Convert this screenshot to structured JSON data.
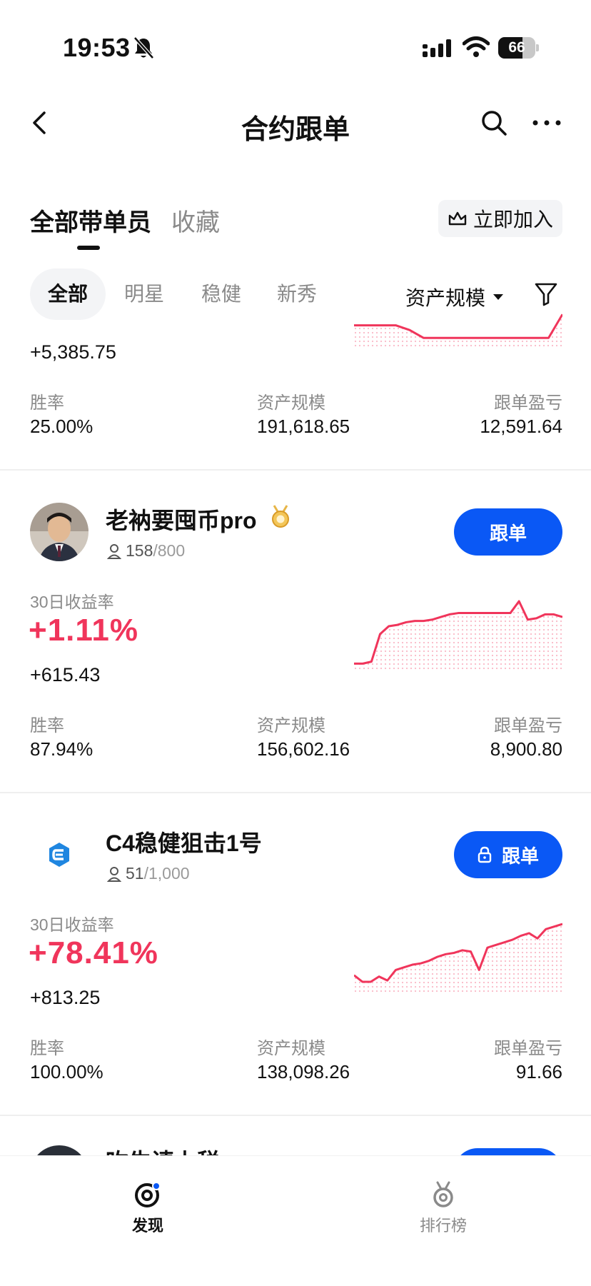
{
  "status_bar": {
    "time": "19:53",
    "battery": "66",
    "battery_level": 0.66
  },
  "header": {
    "title": "合约跟单"
  },
  "tabs": {
    "all": "全部带单员",
    "favorites": "收藏",
    "join": "立即加入"
  },
  "filters": {
    "chips": [
      "全部",
      "明星",
      "稳健",
      "新秀"
    ],
    "sort": "资产规模"
  },
  "stat_labels": {
    "roi": "30日收益率",
    "win_rate": "胜率",
    "aum": "资产规模",
    "copy_pnl": "跟单盈亏"
  },
  "cards": [
    {
      "pnl": "+5,385.75",
      "win_rate": "25.00%",
      "aum": "191,618.65",
      "copy_pnl": "12,591.64",
      "sparkline": [
        0.6,
        0.6,
        0.6,
        0.6,
        0.45,
        0.2,
        0.2,
        0.2,
        0.2,
        0.2,
        0.2,
        0.2,
        0.2,
        0.2,
        0.2,
        0.95
      ]
    },
    {
      "name": "老衲要囤币pro",
      "followers": "158",
      "max_followers": "/800",
      "button": "跟单",
      "locked": false,
      "roi": "+1.11%",
      "pnl": "+615.43",
      "win_rate": "87.94%",
      "aum": "156,602.16",
      "copy_pnl": "8,900.80",
      "sparkline": [
        0.05,
        0.05,
        0.08,
        0.5,
        0.62,
        0.64,
        0.68,
        0.7,
        0.7,
        0.72,
        0.76,
        0.8,
        0.82,
        0.82,
        0.82,
        0.82,
        0.82,
        0.82,
        0.82,
        1.0,
        0.72,
        0.74,
        0.8,
        0.8,
        0.76
      ]
    },
    {
      "name": "C4稳健狙击1号",
      "followers": "51",
      "max_followers": "/1,000",
      "button": "跟单",
      "locked": true,
      "roi": "+78.41%",
      "pnl": "+813.25",
      "win_rate": "100.00%",
      "aum": "138,098.26",
      "copy_pnl": "91.66",
      "sparkline": [
        0.22,
        0.12,
        0.12,
        0.2,
        0.14,
        0.3,
        0.34,
        0.38,
        0.4,
        0.44,
        0.5,
        0.54,
        0.56,
        0.6,
        0.58,
        0.3,
        0.64,
        0.68,
        0.72,
        0.76,
        0.82,
        0.86,
        0.78,
        0.92,
        0.96,
        1.0
      ]
    }
  ],
  "peek": {
    "name": "吹牛请上税pro"
  },
  "bottom_nav": {
    "discover": "发现",
    "ranking": "排行榜"
  },
  "colors": {
    "accent": "#0a58f5",
    "profit": "#f0355b"
  },
  "icons": [
    "back-icon",
    "search-icon",
    "more-icon",
    "crown-icon",
    "filter-icon",
    "medal-icon",
    "person-icon",
    "lock-icon",
    "discover-icon",
    "ranking-icon"
  ]
}
